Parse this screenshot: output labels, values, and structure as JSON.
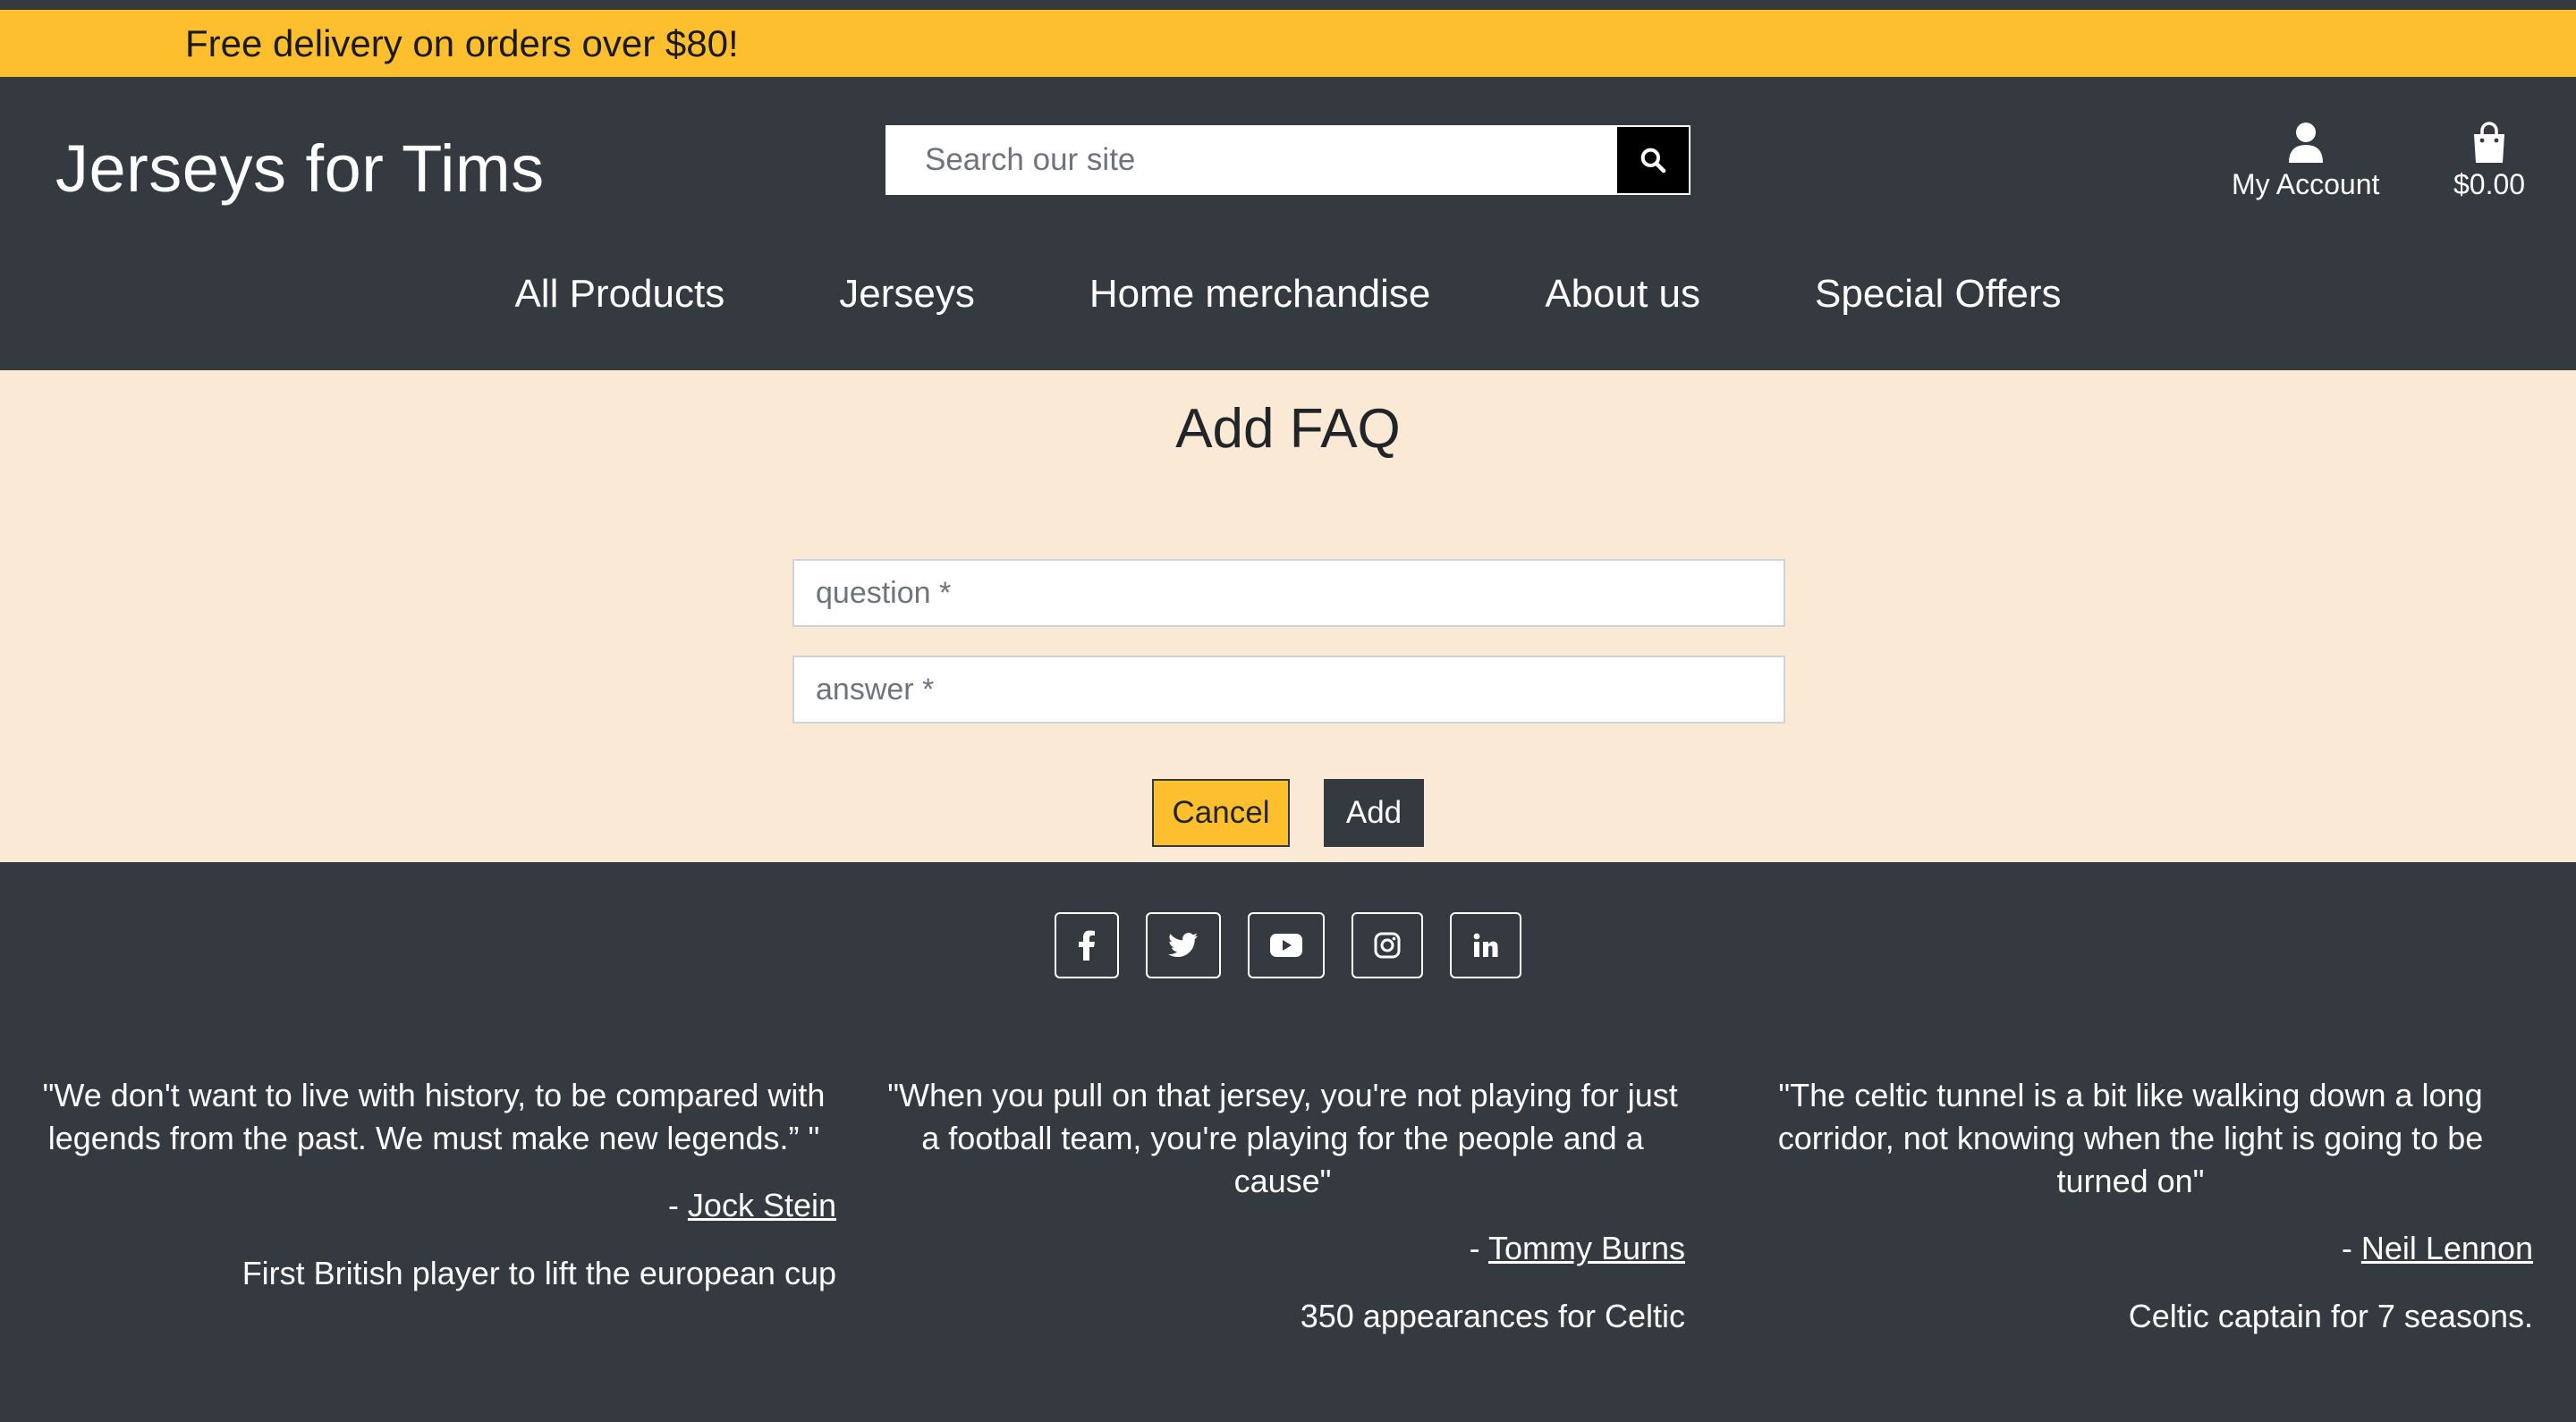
{
  "banner": {
    "text": "Free delivery on orders over $80!"
  },
  "header": {
    "brand": "Jerseys for Tims",
    "search_placeholder": "Search our site",
    "account_label": "My Account",
    "cart_total": "$0.00"
  },
  "nav": {
    "items": [
      "All Products",
      "Jerseys",
      "Home merchandise",
      "About us",
      "Special Offers"
    ]
  },
  "form": {
    "title": "Add FAQ",
    "question_placeholder": "question *",
    "answer_placeholder": "answer *",
    "cancel_label": "Cancel",
    "add_label": "Add"
  },
  "footer": {
    "socials": [
      "facebook-icon",
      "twitter-icon",
      "youtube-icon",
      "instagram-icon",
      "linkedin-icon"
    ],
    "quotes": [
      {
        "text": "\"We don't want to live with history, to be compared with legends from the past. We must make new legends.”  \"",
        "author": "Jock Stein",
        "fact": "First British player to lift the european cup"
      },
      {
        "text": "\"When you pull on that jersey, you're not playing for just a football team, you're playing for the people and a cause\"",
        "author": "Tommy Burns",
        "fact": "350 appearances for Celtic"
      },
      {
        "text": "\"The celtic tunnel is a bit like walking down a long corridor, not knowing when the light is going to be turned on\"",
        "author": "Neil Lennon",
        "fact": "Celtic captain for 7 seasons."
      }
    ]
  },
  "colors": {
    "accent": "#fdbf2d",
    "dark": "#343a40",
    "page_bg": "#f9e9d5"
  }
}
